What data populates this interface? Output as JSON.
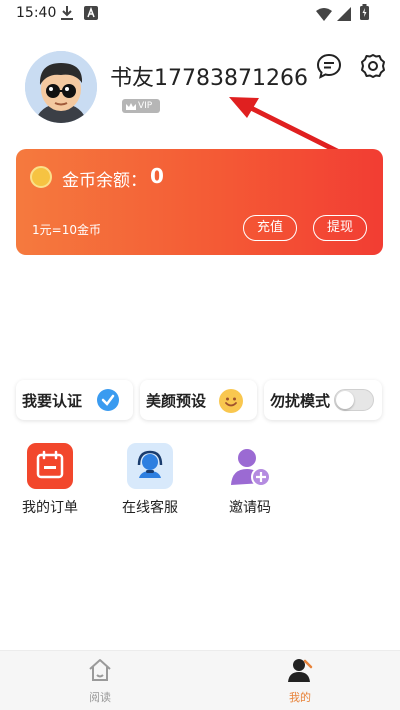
{
  "status_bar": {
    "time": "15:40",
    "icons": [
      "download-icon",
      "notification-a-icon",
      "wifi-icon",
      "signal-icon",
      "battery-icon"
    ]
  },
  "profile": {
    "username": "书友17783871266",
    "vip_label": "VIP"
  },
  "header_icons": [
    "message-icon",
    "settings-icon"
  ],
  "coin_card": {
    "label": "金币余额：",
    "value": "0",
    "rate": "1元=10金币",
    "recharge_label": "充值",
    "withdraw_label": "提现"
  },
  "features": [
    {
      "label": "我要认证",
      "icon": "verified-check-icon"
    },
    {
      "label": "美颜预设",
      "icon": "smile-icon"
    },
    {
      "label": "勿扰模式",
      "icon": "toggle",
      "toggle_on": false
    }
  ],
  "grid": [
    {
      "label": "我的订单",
      "icon": "orders-icon"
    },
    {
      "label": "在线客服",
      "icon": "customer-service-icon"
    },
    {
      "label": "邀请码",
      "icon": "invite-user-icon"
    }
  ],
  "bottom_nav": [
    {
      "label": "阅读",
      "icon": "home-icon",
      "active": false
    },
    {
      "label": "我的",
      "icon": "profile-icon",
      "active": true
    }
  ],
  "colors": {
    "accent": "#f4623a",
    "nav_active": "#e8833a",
    "nav_inactive": "#9a9a9a",
    "annotation_arrow": "#e02020"
  }
}
